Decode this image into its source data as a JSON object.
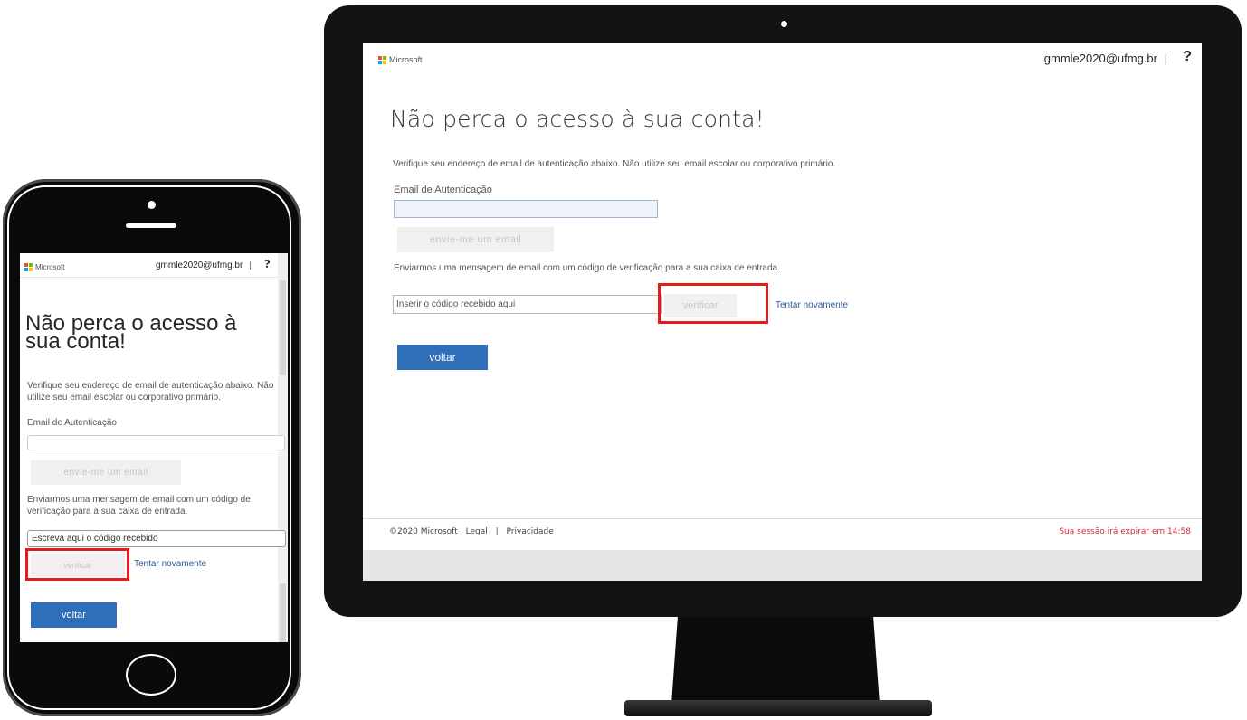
{
  "desktop": {
    "brand": "Microsoft",
    "account": "gmmle2020@ufmg.br",
    "account_separator": "|",
    "help_label": "?",
    "title": "Não perca o acesso à sua conta!",
    "instructions": "Verifique seu endereço de email de autenticação abaixo. Não utilize seu email escolar ou corporativo primário.",
    "email_label": "Email de Autenticação",
    "email_value": "",
    "send_button": "envie-me um email",
    "sent_message": "Enviarmos uma mensagem de email com um código de verificação para a sua caixa de entrada.",
    "code_placeholder": "Inserir o código recebido aqui",
    "verify_button": "verificar",
    "retry_link": "Tentar novamente",
    "back_button": "voltar",
    "footer": {
      "copyright": "©2020 Microsoft",
      "legal": "Legal",
      "separator": "|",
      "privacy": "Privacidade",
      "session": "Sua sessão irá expirar em 14:58"
    }
  },
  "phone": {
    "brand": "Microsoft",
    "account": "gmmle2020@ufmg.br",
    "account_separator": "|",
    "help_label": "?",
    "title": "Não perca o acesso à sua conta!",
    "instructions": "Verifique seu endereço de email de autenticação abaixo. Não utilize seu email escolar ou corporativo primário.",
    "email_label": "Email de Autenticação",
    "email_value": "",
    "send_button": "envie-me um email",
    "sent_message": "Enviarmos uma mensagem de email com um código de verificação para a sua caixa de entrada.",
    "code_placeholder": "Escreva aqui o código recebido",
    "verify_button": "verificar",
    "retry_link": "Tentar novamente",
    "back_button": "voltar"
  },
  "colors": {
    "accent_blue": "#2f6fb9",
    "link_blue": "#2b5d9b",
    "highlight_red": "#e31b1b",
    "session_warning": "#d42a2a",
    "disabled_button_bg": "#f0f0f0"
  },
  "icons": {
    "logo": "microsoft-logo-icon",
    "help": "help-icon",
    "camera": "camera-dot-icon",
    "home": "home-button-icon"
  }
}
